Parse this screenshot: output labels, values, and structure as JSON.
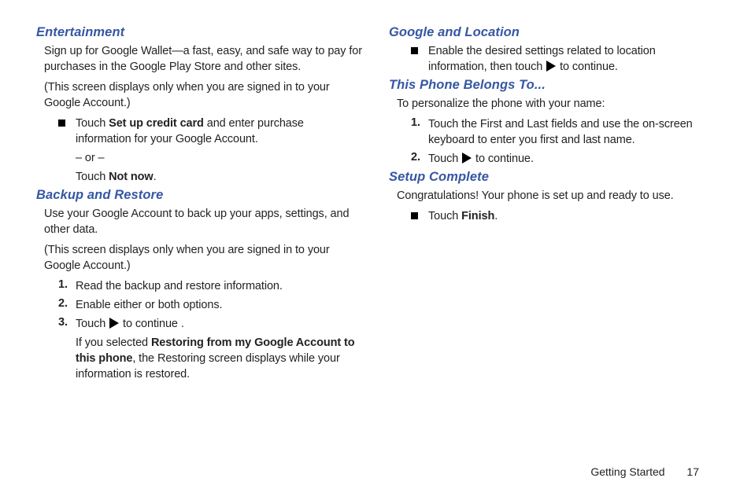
{
  "left": {
    "s1": {
      "title": "Entertainment",
      "p1": "Sign up for Google Wallet—a fast, easy, and safe way to pay for purchases in the Google Play Store and other sites.",
      "p2": "(This screen displays only when you are signed in to your Google Account.)",
      "b1_pre": "Touch ",
      "b1_bold": "Set up credit card",
      "b1_post": " and enter purchase information for your Google Account.",
      "or": "– or –",
      "b2_pre": "Touch ",
      "b2_bold": "Not now",
      "b2_post": "."
    },
    "s2": {
      "title": "Backup and Restore",
      "p1": "Use your Google Account to back up your apps, settings, and other data.",
      "p2": "(This screen displays only when you are signed in to your Google Account.)",
      "n1_num": "1.",
      "n1_text": "Read the backup and restore information.",
      "n2_num": "2.",
      "n2_text": "Enable either or both options.",
      "n3_num": "3.",
      "n3_pre": "Touch ",
      "n3_post": " to continue .",
      "after_pre": "If you selected ",
      "after_bold": "Restoring from my Google Account to this phone",
      "after_post": ", the Restoring screen displays while your information is restored."
    }
  },
  "right": {
    "s1": {
      "title": "Google and Location",
      "b1_pre": "Enable the desired settings related to location information, then touch ",
      "b1_post": " to continue."
    },
    "s2": {
      "title": "This Phone Belongs To...",
      "p1": "To personalize the phone with your name:",
      "n1_num": "1.",
      "n1_text": "Touch the First and Last fields and use the on-screen keyboard to enter you first and last name.",
      "n2_num": "2.",
      "n2_pre": "Touch ",
      "n2_post": " to continue."
    },
    "s3": {
      "title": "Setup Complete",
      "p1": "Congratulations! Your phone is set up and ready to use.",
      "b1_pre": "Touch ",
      "b1_bold": "Finish",
      "b1_post": "."
    }
  },
  "footer": {
    "section": "Getting Started",
    "page": "17"
  }
}
